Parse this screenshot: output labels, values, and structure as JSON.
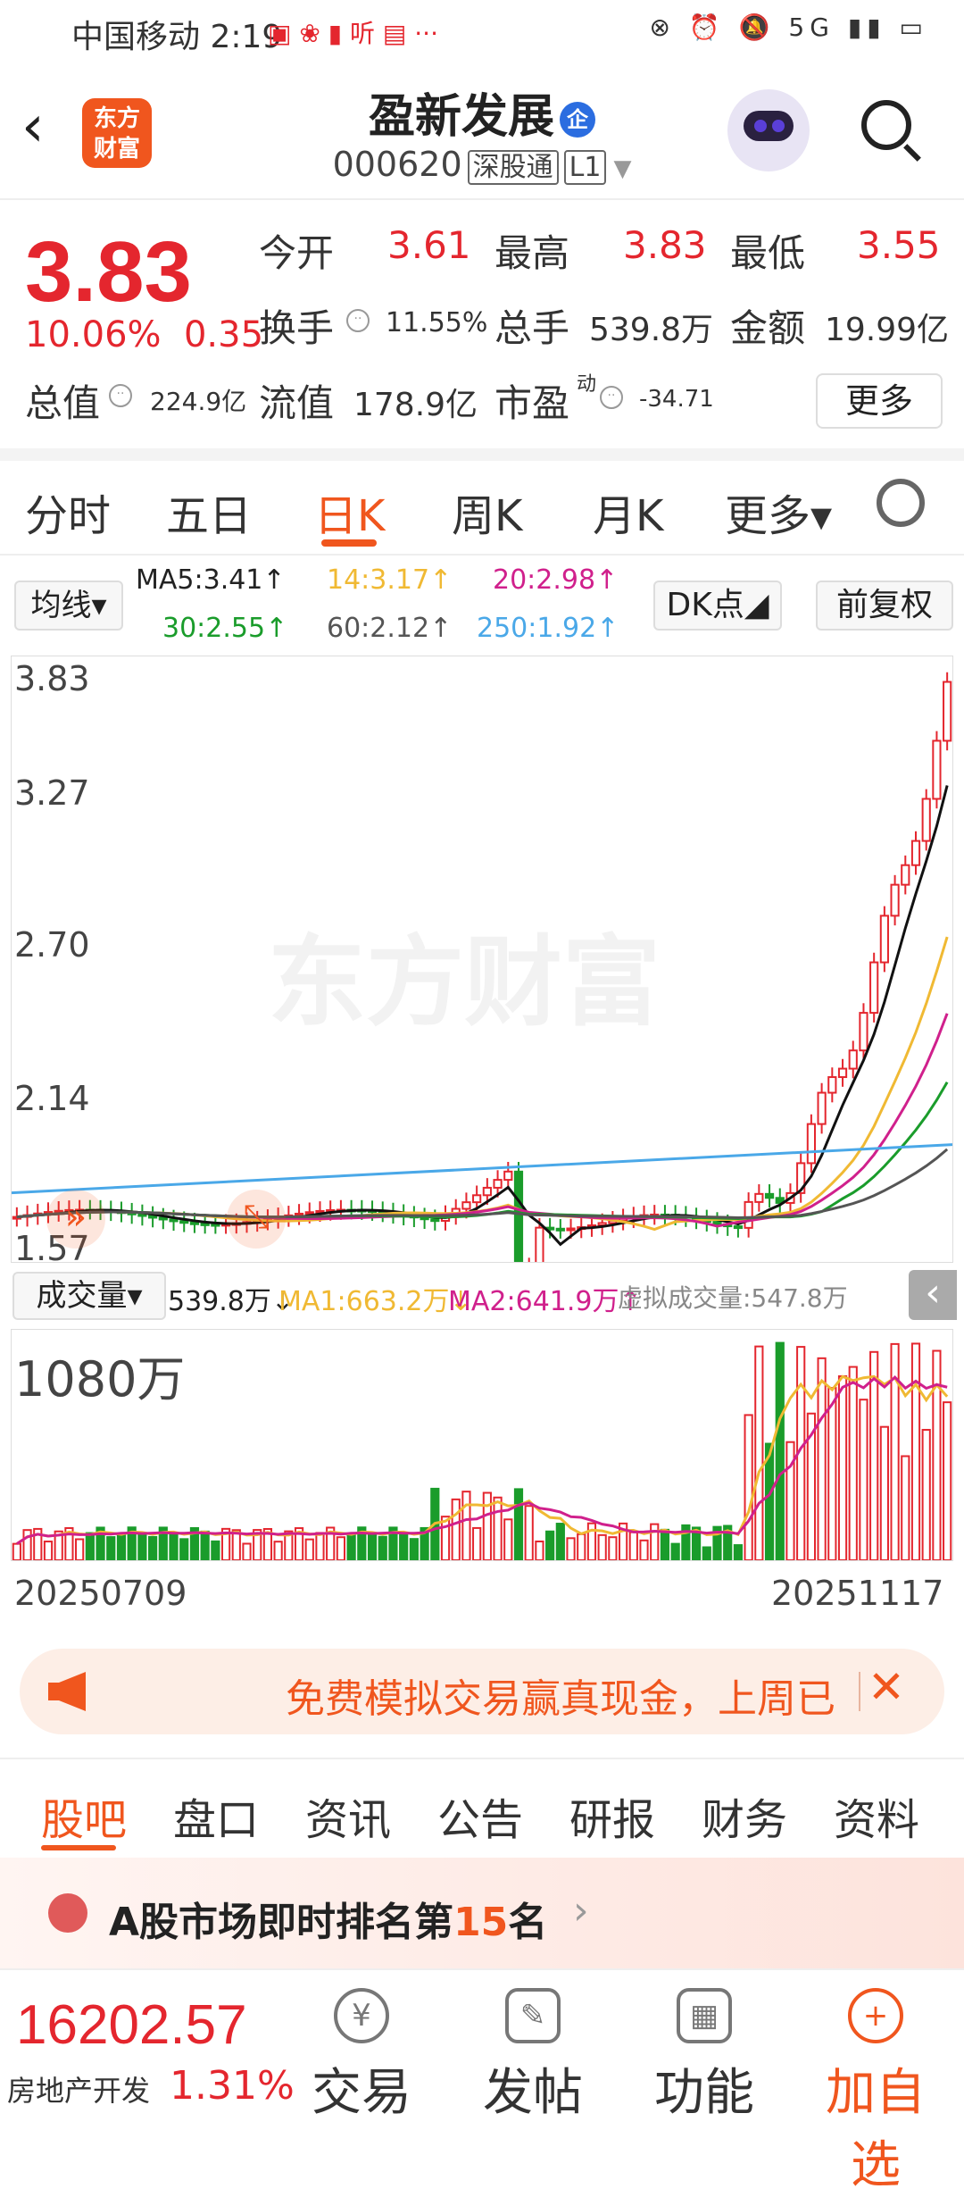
{
  "status_bar": {
    "carrier_time": "中国移动 2:19",
    "left_icons": "▣ ❀ ▮ 听 ▤ ···",
    "right_icons": "⊗ ⏰ 🔕 5G ▮▮ ▭"
  },
  "header": {
    "back_icon": "‹",
    "logo_text": "东方\n财富",
    "stock_name": "盈新发展",
    "badge": "企",
    "stock_code": "000620",
    "tag1": "深股通",
    "tag2": "L1"
  },
  "quote": {
    "price": "3.83",
    "change_pct": "10.06%",
    "change": "0.35",
    "open_label": "今开",
    "open": "3.61",
    "high_label": "最高",
    "high": "3.83",
    "low_label": "最低",
    "low": "3.55",
    "turnover_label": "换手",
    "turnover": "11.55%",
    "volume_label": "总手",
    "volume": "539.8万",
    "amount_label": "金额",
    "amount": "19.99亿",
    "mktcap_label": "总值",
    "mktcap": "224.9亿",
    "float_label": "流值",
    "float": "178.9亿",
    "pe_label": "市盈",
    "pe_sup": "动",
    "pe": "-34.71",
    "more_label": "更多"
  },
  "kline_tabs": [
    "分时",
    "五日",
    "日K",
    "周K",
    "月K",
    "更多▾"
  ],
  "ma_row": {
    "select": "均线▾",
    "ma5": "MA5:3.41↑",
    "ma14": "14:3.17↑",
    "ma20": "20:2.98↑",
    "ma30": "30:2.55↑",
    "ma60": "60:2.12↑",
    "ma250": "250:1.92↑",
    "dk": "DK点◢",
    "fq": "前复权"
  },
  "colors": {
    "up": "#e4262e",
    "down": "#1a9c2b",
    "ma5": "#111111",
    "ma14": "#f0b933",
    "ma20": "#d0208c",
    "ma30": "#1a9c2b",
    "ma60": "#555555",
    "ma250": "#4aa8e8",
    "accent": "#f0561e"
  },
  "kchart": {
    "y_ticks": [
      "3.83",
      "3.27",
      "2.70",
      "2.14",
      "1.57"
    ],
    "watermark": "东方财富"
  },
  "vol_bar": {
    "select": "成交量▾",
    "vol": "539.8万↓",
    "ma1": "MA1:663.2万↓",
    "ma2": "MA2:641.9万↑",
    "virtual": "虚拟成交量:547.8万",
    "collapse_icon": "‹"
  },
  "vol_chart": {
    "max_label": "1080万"
  },
  "dates": {
    "start": "20250709",
    "end": "20251117"
  },
  "promo": {
    "text": "免费模拟交易赢真现金，上周已",
    "close": "✕"
  },
  "section_tabs": [
    "股吧",
    "盘口",
    "资讯",
    "公告",
    "研报",
    "财务",
    "资料"
  ],
  "rank": {
    "prefix": "A股市场即时排名第",
    "num": "15",
    "suffix": "名",
    "arrow": "›"
  },
  "bottom_nav": {
    "index_value": "16202.57",
    "index_name": "房地产开发",
    "index_pct": "1.31%",
    "items": [
      {
        "icon": "¥",
        "label": "交易"
      },
      {
        "icon": "✎",
        "label": "发帖"
      },
      {
        "icon": "▦",
        "label": "功能"
      },
      {
        "icon": "+",
        "label": "加自选"
      }
    ]
  }
}
